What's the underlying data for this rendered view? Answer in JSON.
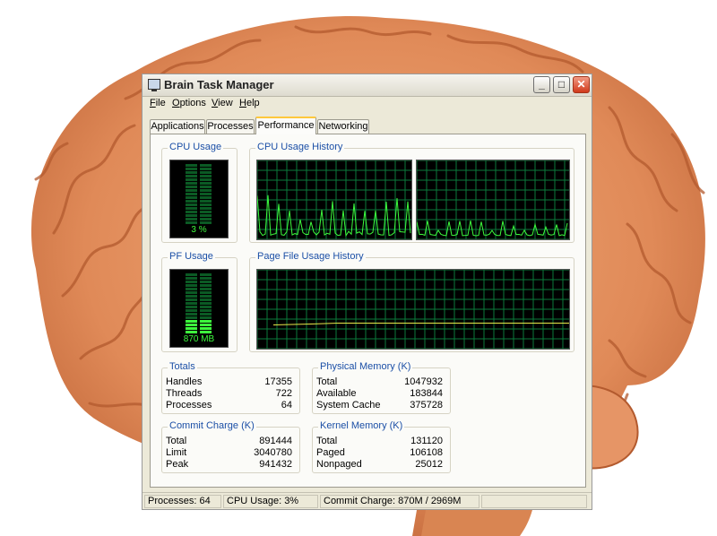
{
  "window": {
    "title": "Brain Task Manager",
    "buttons": {
      "minimize": "_",
      "maximize": "□",
      "close": "✕"
    }
  },
  "menu": [
    {
      "key": "F",
      "rest": "ile"
    },
    {
      "key": "O",
      "rest": "ptions"
    },
    {
      "key": "V",
      "rest": "iew"
    },
    {
      "key": "H",
      "rest": "elp"
    }
  ],
  "tabs": [
    "Applications",
    "Processes",
    "Performance",
    "Networking"
  ],
  "active_tab": "Performance",
  "cpu_usage": {
    "title": "CPU Usage",
    "label": "3 %",
    "percent": 3
  },
  "cpu_history": {
    "title": "CPU Usage History"
  },
  "pf_usage": {
    "title": "PF Usage",
    "label": "870 MB",
    "fraction": 0.29
  },
  "pf_history": {
    "title": "Page File Usage History"
  },
  "totals": {
    "title": "Totals",
    "rows": [
      {
        "label": "Handles",
        "value": "17355"
      },
      {
        "label": "Threads",
        "value": "722"
      },
      {
        "label": "Processes",
        "value": "64"
      }
    ]
  },
  "physical_memory": {
    "title": "Physical Memory (K)",
    "rows": [
      {
        "label": "Total",
        "value": "1047932"
      },
      {
        "label": "Available",
        "value": "183844"
      },
      {
        "label": "System Cache",
        "value": "375728"
      }
    ]
  },
  "commit_charge": {
    "title": "Commit Charge (K)",
    "rows": [
      {
        "label": "Total",
        "value": "891444"
      },
      {
        "label": "Limit",
        "value": "3040780"
      },
      {
        "label": "Peak",
        "value": "941432"
      }
    ]
  },
  "kernel_memory": {
    "title": "Kernel Memory (K)",
    "rows": [
      {
        "label": "Total",
        "value": "131120"
      },
      {
        "label": "Paged",
        "value": "106108"
      },
      {
        "label": "Nonpaged",
        "value": "25012"
      }
    ]
  },
  "status": {
    "processes": "Processes: 64",
    "cpu": "CPU Usage: 3%",
    "commit": "Commit Charge: 870M / 2969M"
  },
  "colors": {
    "graph_line": "#3dfa3d",
    "grid": "#0b7a3b",
    "pf_line": "#e8e84a",
    "group_title": "#1b4fa6"
  }
}
